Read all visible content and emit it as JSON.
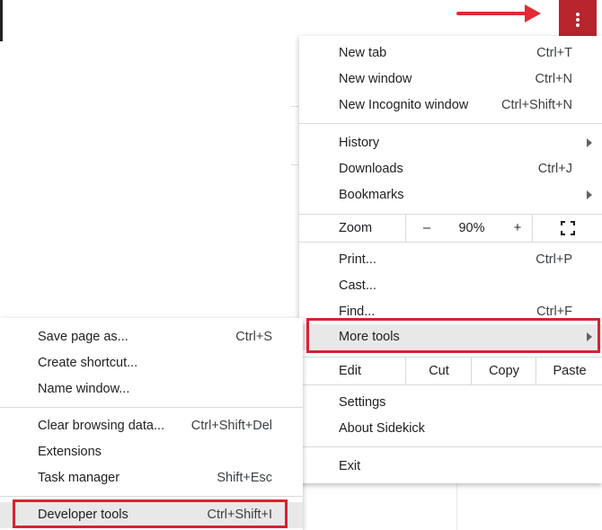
{
  "main_menu": {
    "new_tab": {
      "label": "New tab",
      "shortcut": "Ctrl+T"
    },
    "new_window": {
      "label": "New window",
      "shortcut": "Ctrl+N"
    },
    "new_incognito": {
      "label": "New Incognito window",
      "shortcut": "Ctrl+Shift+N"
    },
    "history": {
      "label": "History"
    },
    "downloads": {
      "label": "Downloads",
      "shortcut": "Ctrl+J"
    },
    "bookmarks": {
      "label": "Bookmarks"
    },
    "zoom": {
      "label": "Zoom",
      "minus": "–",
      "value": "90%",
      "plus": "+"
    },
    "print": {
      "label": "Print...",
      "shortcut": "Ctrl+P"
    },
    "cast": {
      "label": "Cast..."
    },
    "find": {
      "label": "Find...",
      "shortcut": "Ctrl+F"
    },
    "more_tools": {
      "label": "More tools"
    },
    "edit": {
      "label": "Edit",
      "cut": "Cut",
      "copy": "Copy",
      "paste": "Paste"
    },
    "settings": {
      "label": "Settings"
    },
    "about": {
      "label": "About Sidekick"
    },
    "exit": {
      "label": "Exit"
    }
  },
  "more_tools_menu": {
    "save_page": {
      "label": "Save page as...",
      "shortcut": "Ctrl+S"
    },
    "create_shortcut": {
      "label": "Create shortcut..."
    },
    "name_window": {
      "label": "Name window..."
    },
    "clear_data": {
      "label": "Clear browsing data...",
      "shortcut": "Ctrl+Shift+Del"
    },
    "extensions": {
      "label": "Extensions"
    },
    "task_manager": {
      "label": "Task manager",
      "shortcut": "Shift+Esc"
    },
    "developer_tools": {
      "label": "Developer tools",
      "shortcut": "Ctrl+Shift+I"
    }
  },
  "icons": {
    "menu_button": "three-dots-vertical-icon",
    "submenu_arrow": "triangle-right-icon",
    "fullscreen": "fullscreen-icon",
    "annotation_arrow": "arrow-right-icon"
  },
  "colors": {
    "menu_button_bg": "#b7252d",
    "annotation_red": "#e22a34",
    "highlight_border": "#d8232f",
    "hover_bg": "#e8e8e8"
  }
}
